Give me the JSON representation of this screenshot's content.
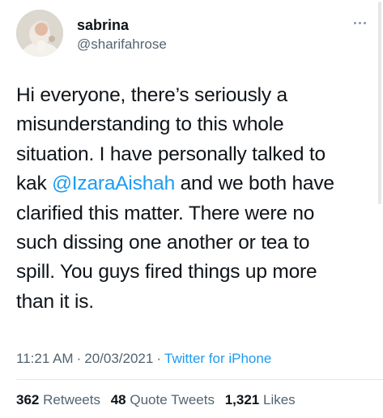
{
  "user": {
    "display_name": "sabrina",
    "handle": "@sharifahrose",
    "avatar_icon": "profile-photo"
  },
  "tweet": {
    "lines": [
      "Hi everyone, there’s seriously a",
      "misunderstanding to this whole",
      "situation. I have personally talked to",
      "kak ",
      "@IzaraAishah",
      " and we both have",
      "clarified this matter. There were no",
      "such dissing one another or tea to",
      "spill. You guys fired things up more",
      "than it is."
    ]
  },
  "meta": {
    "time": "11:21 AM",
    "date": "20/03/2021",
    "separator": "·",
    "source": "Twitter for iPhone"
  },
  "stats": {
    "retweets_count": "362",
    "retweets_label": "Retweets",
    "quotes_count": "48",
    "quotes_label": "Quote Tweets",
    "likes_count": "1,321",
    "likes_label": "Likes"
  },
  "colors": {
    "link": "#1d9bf0",
    "secondary": "#536471",
    "text": "#0f1419"
  },
  "icons": [
    "more-icon"
  ]
}
